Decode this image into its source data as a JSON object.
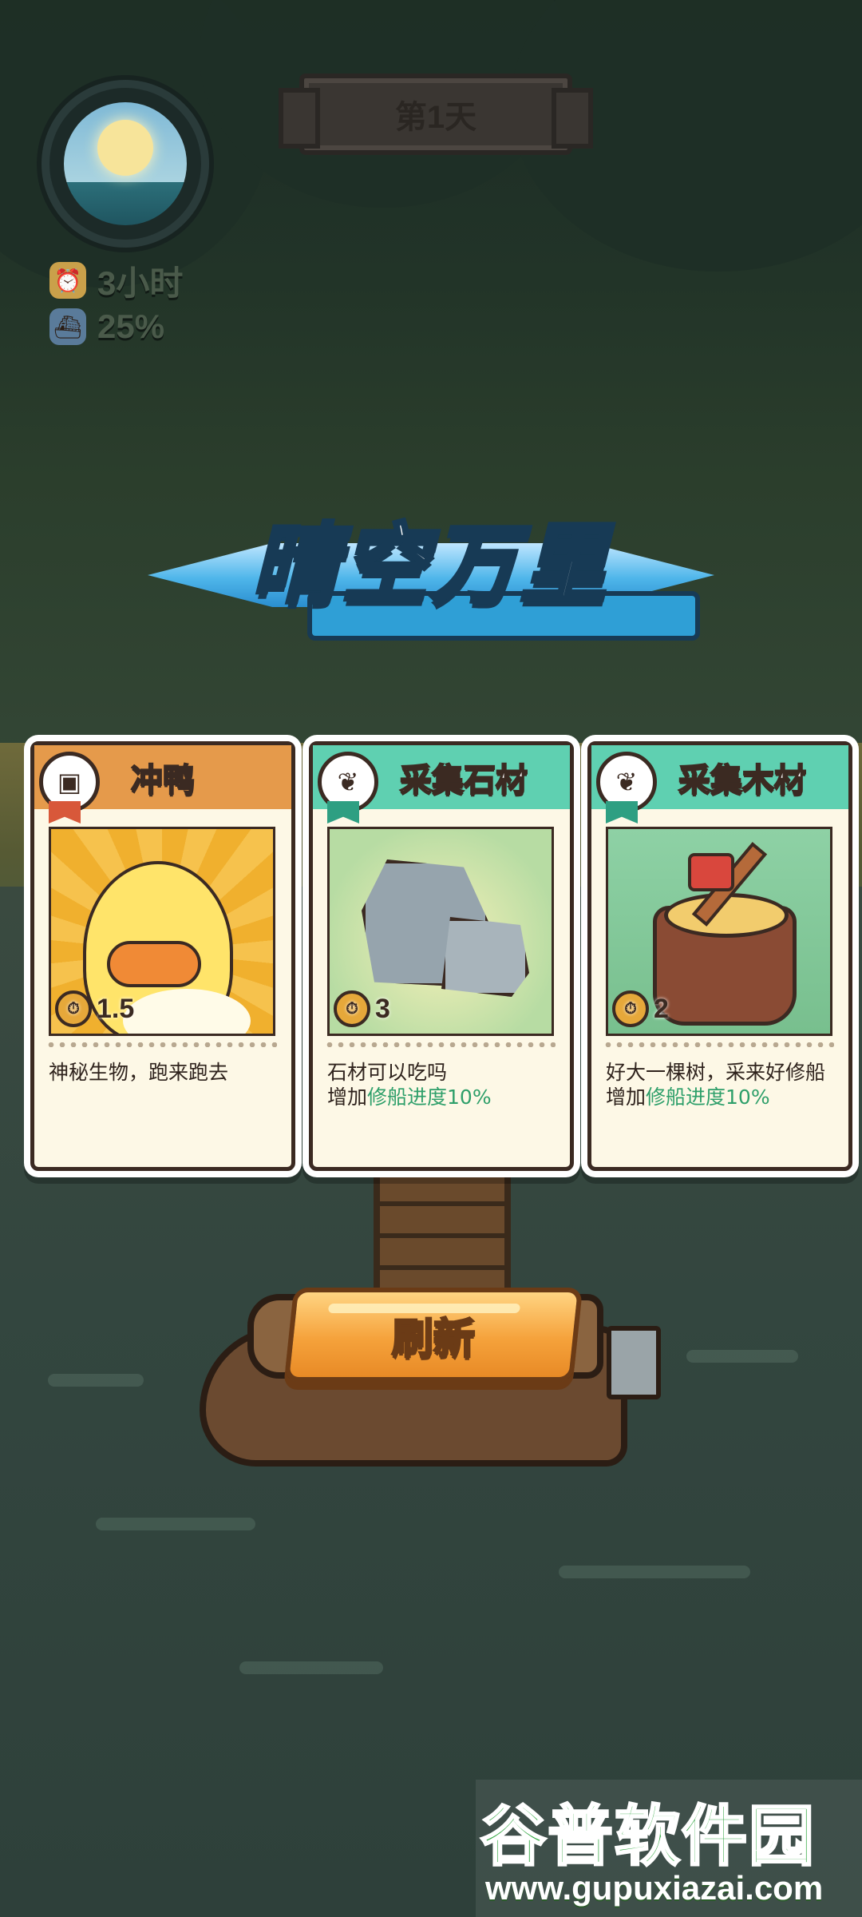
{
  "hud": {
    "day_label": "第1天",
    "time_left": "3小时",
    "repair_progress": "25%",
    "icons": {
      "weather": "sunny-weather-icon",
      "time": "alarm-clock-icon",
      "progress": "ship-icon"
    }
  },
  "weather_title": "晴空万里",
  "cards": [
    {
      "title": "冲鸭",
      "category_icon": "treasure-chest-icon",
      "art": "duck-illustration",
      "cost": "1.5",
      "desc_line1": "神秘生物，跑来跑去",
      "desc_prefix": "",
      "desc_highlight": "",
      "header_color": "#e59a4b"
    },
    {
      "title": "采集石材",
      "category_icon": "leaf-icon",
      "art": "rock-illustration",
      "cost": "3",
      "desc_line1": "石材可以吃吗",
      "desc_prefix": "增加",
      "desc_highlight": "修船进度10%",
      "header_color": "#5fd0b1"
    },
    {
      "title": "采集木材",
      "category_icon": "leaf-icon",
      "art": "tree-stump-illustration",
      "cost": "2",
      "desc_line1": "好大一棵树，采来好修船",
      "desc_prefix": "增加",
      "desc_highlight": "修船进度10%",
      "header_color": "#5fd0b1"
    }
  ],
  "refresh_button": "刷新",
  "watermark": {
    "brand": "谷普软件园",
    "url": "www.gupuxiazai.com"
  },
  "colors": {
    "highlight": "#2e9f6a",
    "button": "#f5a23b"
  }
}
